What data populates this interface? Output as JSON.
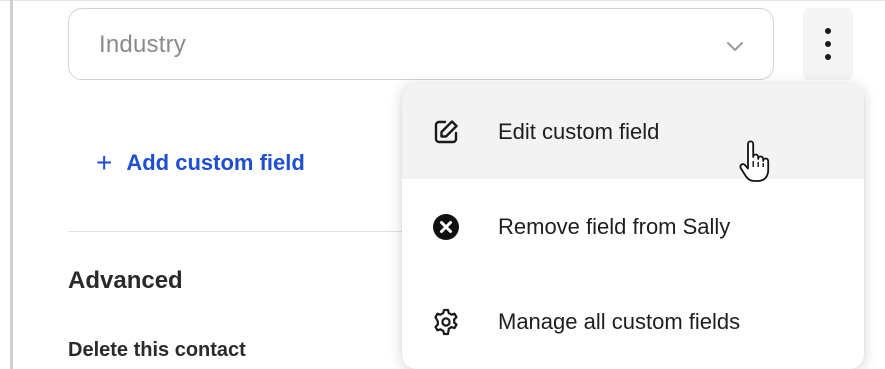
{
  "field": {
    "selected_value": "Industry",
    "chevron_icon": "chevron-down-icon",
    "more_icon": "vertical-ellipsis-icon"
  },
  "add_custom_field": {
    "plus": "+",
    "label": "Add custom field",
    "color": "#1f4fd1"
  },
  "advanced": {
    "heading": "Advanced",
    "delete_label": "Delete this contact"
  },
  "menu": {
    "items": [
      {
        "icon": "edit-icon",
        "label": "Edit custom field",
        "hovered": true
      },
      {
        "icon": "remove-circle-icon",
        "label": "Remove field from Sally",
        "hovered": false
      },
      {
        "icon": "gear-icon",
        "label": "Manage all custom fields",
        "hovered": false
      }
    ]
  },
  "cursor": "pointer-hand-cursor"
}
